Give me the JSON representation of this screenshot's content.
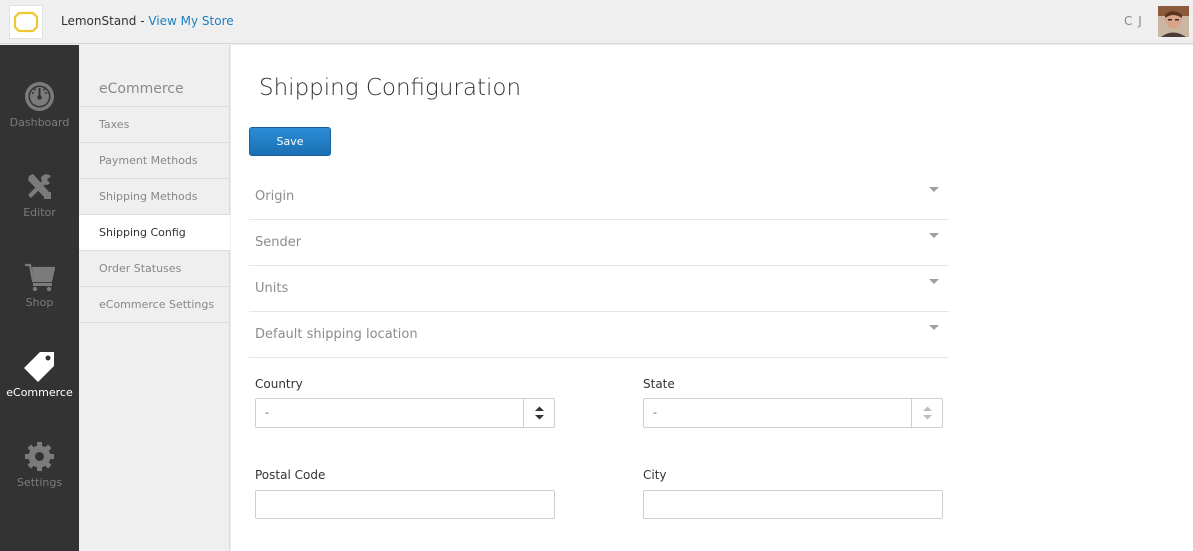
{
  "header": {
    "store_name": "LemonStand",
    "separator": " - ",
    "view_store_link": "View My Store",
    "user_initials": "C J"
  },
  "leftnav": {
    "items": [
      {
        "label": "Dashboard",
        "icon": "dashboard-gauge-icon",
        "active": false
      },
      {
        "label": "Editor",
        "icon": "tools-icon",
        "active": false
      },
      {
        "label": "Shop",
        "icon": "shopping-cart-icon",
        "active": false
      },
      {
        "label": "eCommerce",
        "icon": "price-tag-icon",
        "active": true
      },
      {
        "label": "Settings",
        "icon": "gear-icon",
        "active": false
      }
    ]
  },
  "subnav": {
    "title": "eCommerce",
    "items": [
      {
        "label": "Taxes",
        "active": false
      },
      {
        "label": "Payment Methods",
        "active": false
      },
      {
        "label": "Shipping Methods",
        "active": false
      },
      {
        "label": "Shipping Config",
        "active": true
      },
      {
        "label": "Order Statuses",
        "active": false
      },
      {
        "label": "eCommerce Settings",
        "active": false
      }
    ]
  },
  "main": {
    "title": "Shipping Configuration",
    "save_label": "Save",
    "sections": [
      {
        "label": "Origin"
      },
      {
        "label": "Sender"
      },
      {
        "label": "Units"
      },
      {
        "label": "Default shipping location"
      }
    ],
    "fields": {
      "country": {
        "label": "Country",
        "value": "-"
      },
      "state": {
        "label": "State",
        "value": "-"
      },
      "postal_code": {
        "label": "Postal Code",
        "value": ""
      },
      "city": {
        "label": "City",
        "value": ""
      }
    }
  },
  "colors": {
    "accent": "#1a7fc4",
    "button": "#2180c8",
    "nav_dark": "#333333",
    "logo_yellow": "#f2c630"
  }
}
